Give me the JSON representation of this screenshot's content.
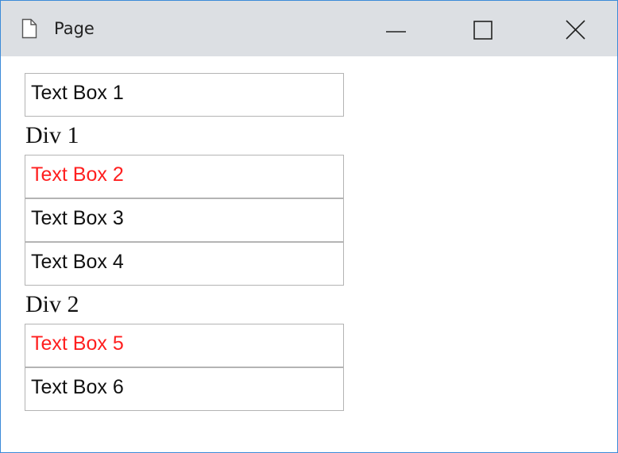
{
  "window": {
    "title": "Page",
    "icon": "page-icon",
    "controls": [
      "minimize-icon",
      "maximize-icon",
      "close-icon"
    ]
  },
  "content": {
    "text_box_1": "Text Box 1",
    "div_1": "Div 1",
    "text_box_2": "Text Box 2",
    "text_box_3": "Text Box 3",
    "text_box_4": "Text Box 4",
    "div_2": "Div 2",
    "text_box_5": "Text Box 5",
    "text_box_6": "Text Box 6"
  },
  "colors": {
    "highlight_text": "#ff1f1f",
    "titlebar": "#dcdfe3",
    "window_border": "#3c8ad8"
  }
}
